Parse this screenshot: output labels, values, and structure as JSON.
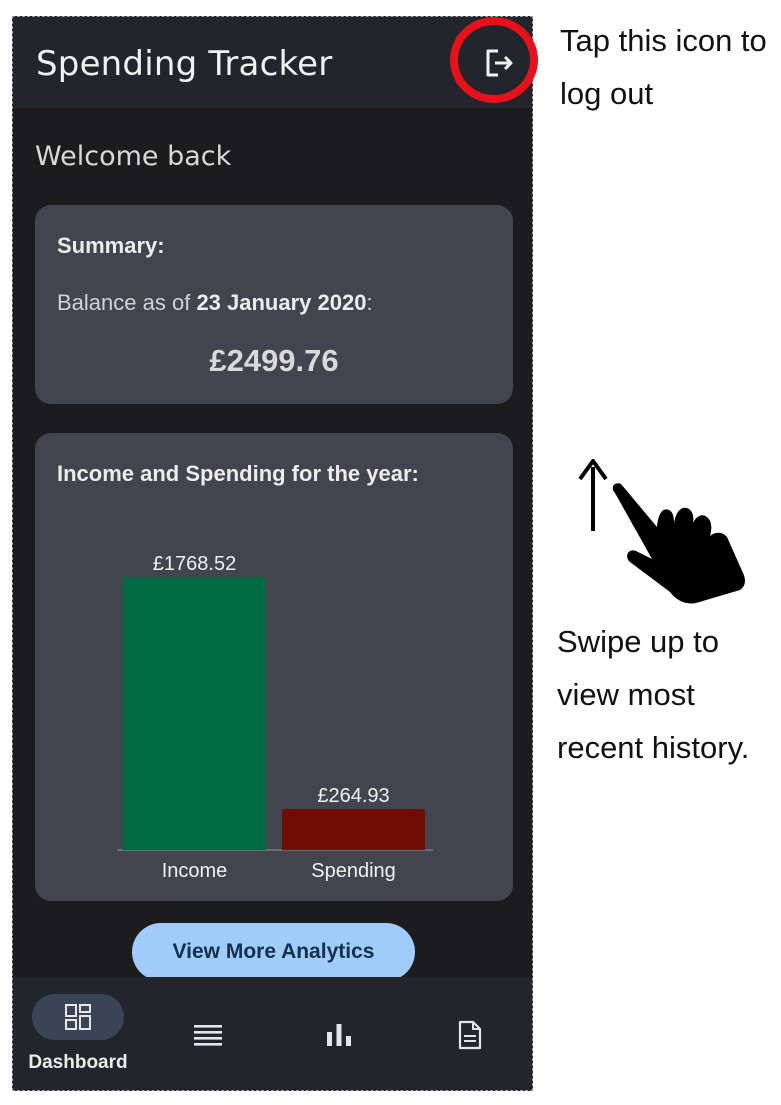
{
  "app": {
    "title": "Spending Tracker",
    "welcome": "Welcome back"
  },
  "summary": {
    "heading": "Summary:",
    "balance_prefix": "Balance as of ",
    "balance_date": "23 January 2020",
    "balance_suffix": ":",
    "balance_amount": "£2499.76"
  },
  "chart_card": {
    "heading": "Income and Spending for the year:"
  },
  "chart_data": {
    "type": "bar",
    "categories": [
      "Income",
      "Spending"
    ],
    "values": [
      1768.52,
      264.93
    ],
    "value_labels": [
      "£1768.52",
      "£264.93"
    ],
    "colors": [
      "#006a44",
      "#700d04"
    ],
    "ylim": [
      0,
      1768.52
    ]
  },
  "actions": {
    "analytics_label": "View More Analytics"
  },
  "nav": {
    "items": [
      {
        "label": "Dashboard",
        "icon": "dashboard-grid-icon",
        "active": true
      },
      {
        "label": "",
        "icon": "list-icon",
        "active": false
      },
      {
        "label": "",
        "icon": "bar-chart-icon",
        "active": false
      },
      {
        "label": "",
        "icon": "document-icon",
        "active": false
      }
    ]
  },
  "annotations": {
    "logout_note": "Tap this icon to log out",
    "swipe_note": "Swipe up to view most recent history."
  },
  "colors": {
    "background": "#1c1c1f",
    "card": "#42454d",
    "appbar": "#23252d",
    "button": "#9fccf8",
    "highlight_ring": "#e8111b"
  }
}
